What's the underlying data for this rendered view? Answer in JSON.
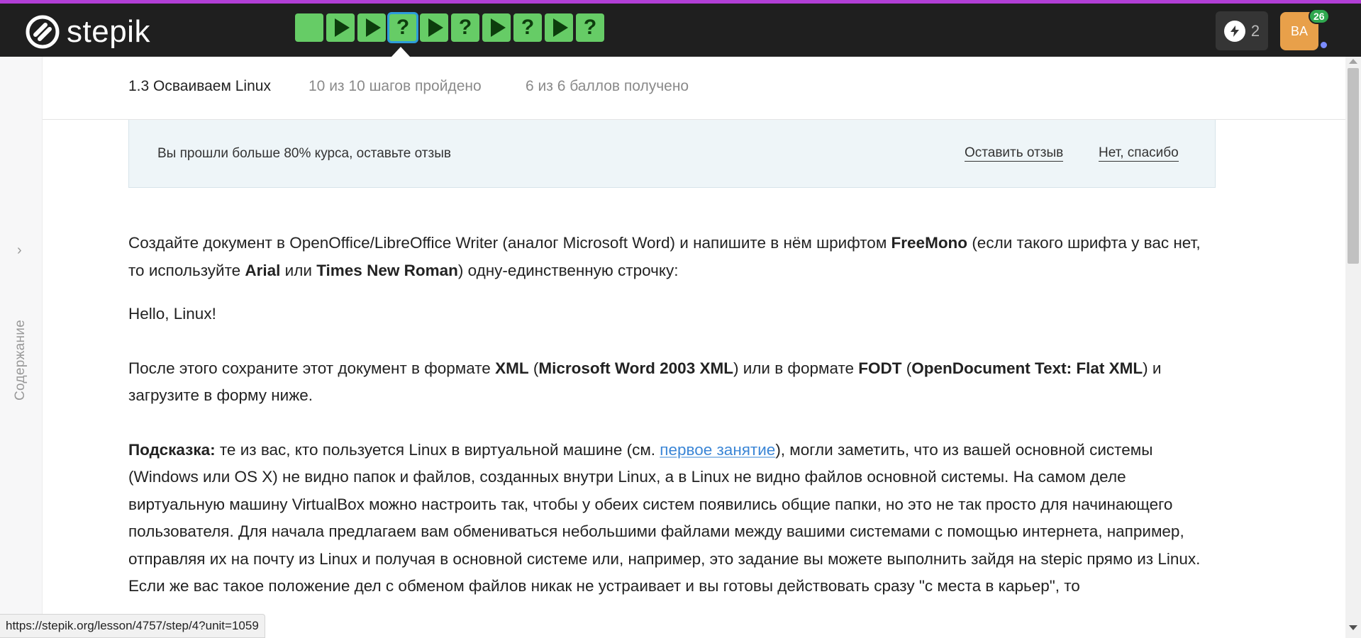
{
  "app": {
    "logo_text": "stepik",
    "accent_color": "#b23fd6"
  },
  "steps": [
    {
      "type": "text",
      "state": "passed"
    },
    {
      "type": "video",
      "state": "passed"
    },
    {
      "type": "video",
      "state": "passed"
    },
    {
      "type": "quiz",
      "state": "passed",
      "current": true,
      "symbol": "?"
    },
    {
      "type": "video",
      "state": "passed"
    },
    {
      "type": "quiz",
      "state": "passed",
      "symbol": "?"
    },
    {
      "type": "video",
      "state": "passed"
    },
    {
      "type": "quiz",
      "state": "passed",
      "symbol": "?"
    },
    {
      "type": "video",
      "state": "passed"
    },
    {
      "type": "quiz",
      "state": "passed",
      "symbol": "?"
    }
  ],
  "header": {
    "energy_count": "2",
    "avatar_initials": "BA",
    "notification_count": "26"
  },
  "sidebar": {
    "label": "Содержание",
    "chevron": "›"
  },
  "lesson": {
    "title": "1.3 Осваиваем Linux",
    "progress": "10 из 10 шагов пройдено",
    "score": "6 из 6 баллов  получено"
  },
  "feedback": {
    "text": "Вы прошли больше 80% курса, оставьте отзыв",
    "leave_label": "Оставить отзыв",
    "decline_label": "Нет, спасибо"
  },
  "content": {
    "p1_a": "Создайте документ в OpenOffice/LibreOffice Writer (аналог Microsoft Word) и напишите в нём шрифтом ",
    "p1_b": "FreeMono",
    "p1_c": " (если такого шрифта у вас нет, то используйте ",
    "p1_d": "Arial",
    "p1_e": " или ",
    "p1_f": "Times New Roman",
    "p1_g": ") одну-единственную строчку:",
    "hello": "Hello, Linux!",
    "p2_a": "После этого сохраните этот документ в формате ",
    "p2_b": "XML",
    "p2_c": " (",
    "p2_d": "Microsoft Word 2003 XML",
    "p2_e": ") или в формате ",
    "p2_f": "FODT",
    "p2_g": " (",
    "p2_h": "OpenDocument Text: Flat XML",
    "p2_i": ") и загрузите в форму ниже.",
    "hint_label": "Подсказка:",
    "hint_a": " те из вас, кто пользуется Linux в виртуальной машине (см. ",
    "hint_link": "первое занятие",
    "hint_b": "), могли заметить, что из вашей основной системы (Windows или OS X) не видно папок и файлов, созданных внутри Linux, а в Linux не видно файлов основной системы. На самом деле виртуальную машину VirtualBox можно настроить так, чтобы у обеих систем появились общие папки, но это не так просто для начинающего пользователя. Для начала предлагаем вам обмениваться небольшими файлами между вашими системами с помощью интернета, например, отправляя их на почту из Linux и получая в основной системе или, например, это задание вы можете выполнить зайдя на stepic прямо из Linux.",
    "p4": "Если же вас такое положение дел с обменом файлов никак не устраивает и вы готовы действовать сразу \"с места в карьер\", то"
  },
  "statusbar": {
    "url": "https://stepik.org/lesson/4757/step/4?unit=1059"
  }
}
